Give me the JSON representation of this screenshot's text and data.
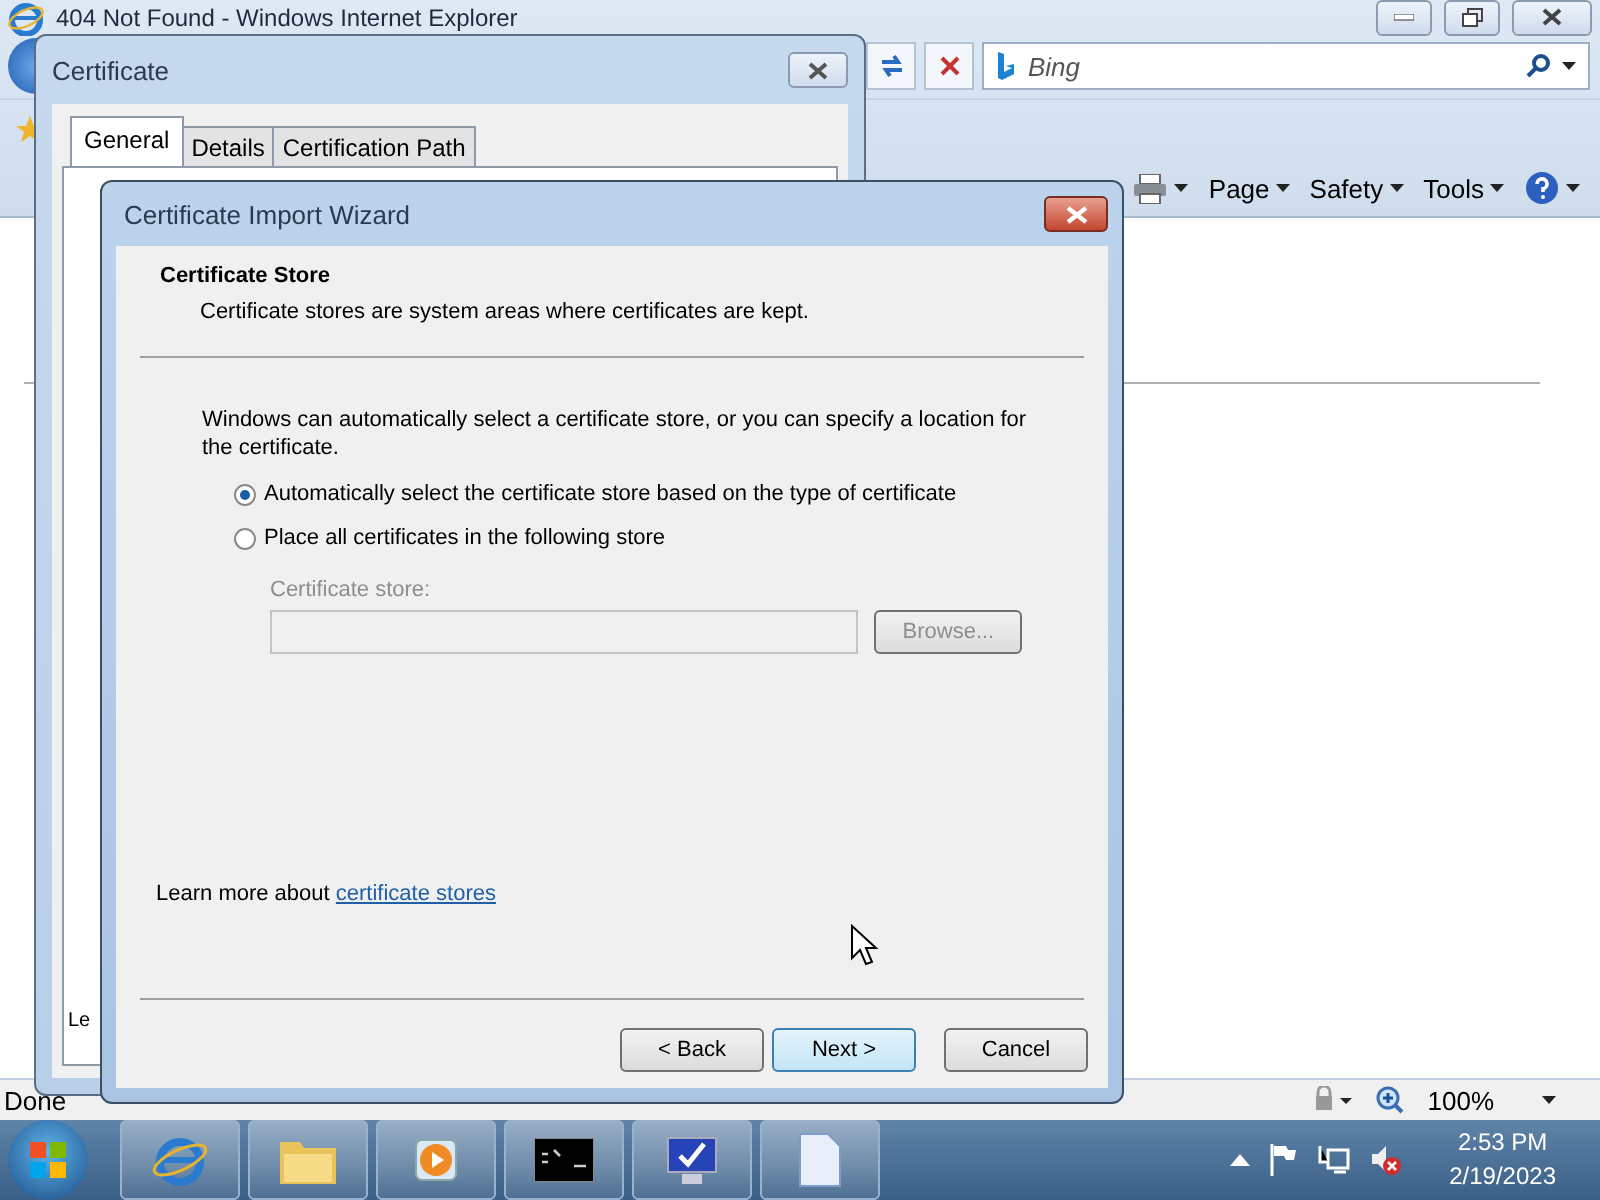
{
  "browser": {
    "title": "404 Not Found - Windows Internet Explorer",
    "search_placeholder": "Bing",
    "command_menus": [
      "Page",
      "Safety",
      "Tools"
    ],
    "status": "Done",
    "zoom": "100%"
  },
  "certificate_dialog": {
    "title": "Certificate",
    "tabs": [
      {
        "label": "General",
        "selected": true
      },
      {
        "label": "Details",
        "selected": false
      },
      {
        "label": "Certification Path",
        "selected": false
      }
    ],
    "body_text": "Le"
  },
  "wizard": {
    "title": "Certificate Import Wizard",
    "heading": "Certificate Store",
    "subheading": "Certificate stores are system areas where certificates are kept.",
    "intro": "Windows can automatically select a certificate store, or you can specify a location for the certificate.",
    "options": [
      {
        "label": "Automatically select the certificate store based on the type of certificate",
        "selected": true
      },
      {
        "label": "Place all certificates in the following store",
        "selected": false
      }
    ],
    "store": {
      "label": "Certificate store:",
      "browse": "Browse...",
      "disabled": true
    },
    "learn_more": {
      "text": "Learn more about",
      "link": "certificate stores"
    },
    "buttons": [
      {
        "label": "< Back",
        "default": false
      },
      {
        "label": "Next >",
        "default": true
      },
      {
        "label": "Cancel",
        "default": false
      }
    ]
  },
  "taskbar": {
    "time": "2:53 PM",
    "date": "2/19/2023"
  }
}
